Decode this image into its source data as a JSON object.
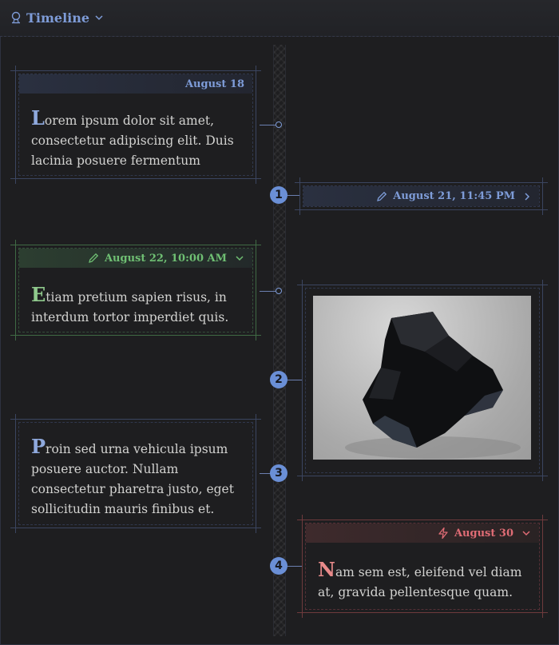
{
  "header": {
    "title": "Timeline",
    "icon": "shield-icon",
    "chevron": "chevron-down-icon"
  },
  "colors": {
    "blue": "#7e9cd8",
    "green": "#6fbf73",
    "red": "#e06c75",
    "background": "#1e1e20"
  },
  "markers": [
    "1",
    "2",
    "3",
    "4"
  ],
  "events": [
    {
      "date": "August 18",
      "text_initial": "L",
      "text_rest": "orem ipsum dolor sit amet, consectetur adipiscing elit. Duis lacinia posuere fermentum",
      "color": "blue"
    },
    {
      "date": "August 21, 11:45 PM",
      "icon": "pencil-icon",
      "toggle": "chevron-right-icon",
      "color": "blue"
    },
    {
      "date": "August 22, 10:00 AM",
      "icon": "pencil-icon",
      "toggle": "chevron-down-icon",
      "text_initial": "E",
      "text_rest": "tiam pretium sapien risus, in interdum tortor imperdiet quis.",
      "color": "green"
    },
    {
      "type": "image",
      "image_alt": "black obsidian rock",
      "color": "blue"
    },
    {
      "text_initial": "P",
      "text_rest": "roin sed urna vehicula ipsum posuere auctor. Nullam consectetur pharetra justo, eget sollicitudin mauris finibus et.",
      "color": "blue"
    },
    {
      "date": "August 30",
      "icon": "lightning-icon",
      "toggle": "chevron-down-icon",
      "text_initial": "N",
      "text_rest": "am sem est, eleifend vel diam at, gravida pellentesque quam.",
      "color": "red"
    }
  ]
}
